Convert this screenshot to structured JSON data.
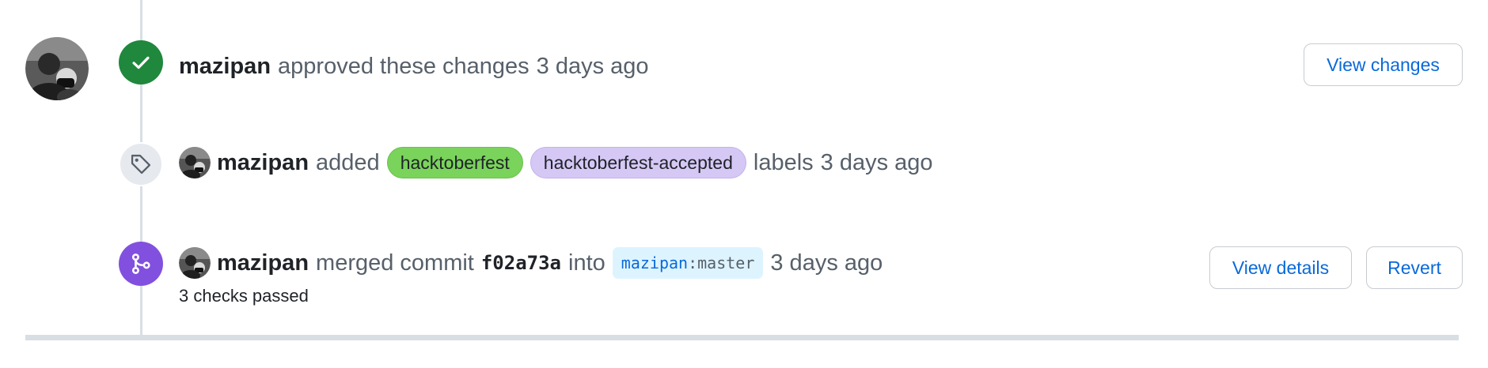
{
  "events": {
    "approved": {
      "author": "mazipan",
      "action": "approved these changes",
      "time": "3 days ago",
      "button": "View changes"
    },
    "labeled": {
      "author": "mazipan",
      "action": "added",
      "labels": [
        {
          "name": "hacktoberfest",
          "color": "#7ad35b"
        },
        {
          "name": "hacktoberfest-accepted",
          "color": "#d6c8f5"
        }
      ],
      "suffix": "labels",
      "time": "3 days ago"
    },
    "merged": {
      "author": "mazipan",
      "action": "merged commit",
      "sha": "f02a73a",
      "into": "into",
      "branch_owner": "mazipan",
      "branch_sep": ":",
      "branch_name": "master",
      "time": "3 days ago",
      "checks": "3 checks passed",
      "view_details": "View details",
      "revert": "Revert"
    }
  },
  "icons": {
    "approved": "check-icon",
    "labeled": "tag-icon",
    "merged": "git-merge-icon"
  },
  "colors": {
    "approved_badge": "#1f883d",
    "merged_badge": "#8250df",
    "link": "#0969da"
  }
}
